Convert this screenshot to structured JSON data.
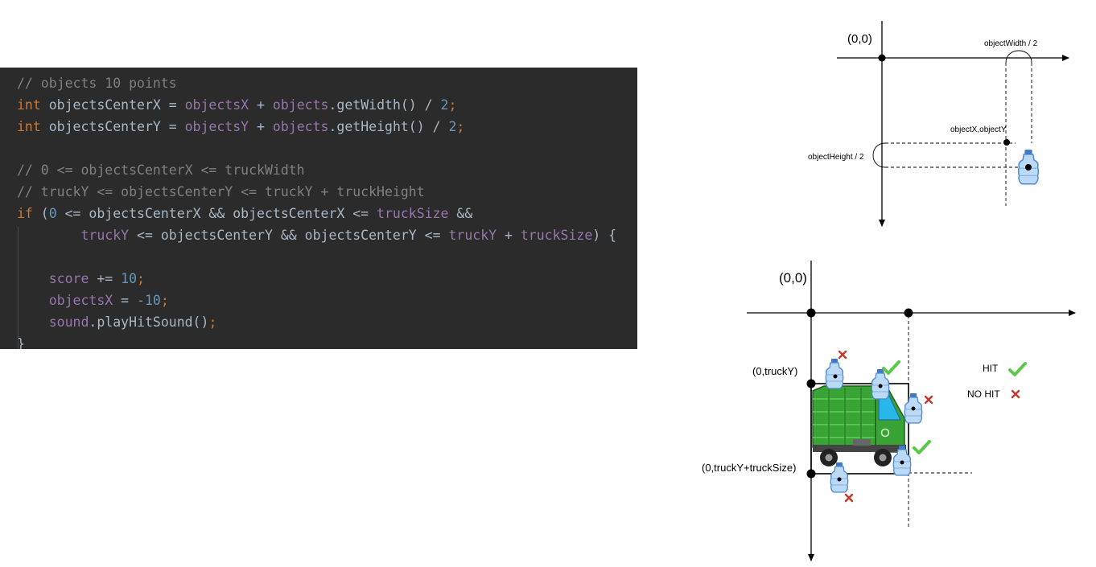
{
  "code": {
    "lines": [
      [
        {
          "t": "// objects 10 points",
          "c": "comment"
        }
      ],
      [
        {
          "t": "int",
          "c": "keyword"
        },
        {
          "t": " objectsCenterX = ",
          "c": "ident"
        },
        {
          "t": "objectsX",
          "c": "field"
        },
        {
          "t": " + ",
          "c": "plain"
        },
        {
          "t": "objects",
          "c": "field"
        },
        {
          "t": ".getWidth() / ",
          "c": "method"
        },
        {
          "t": "2",
          "c": "number"
        },
        {
          "t": ";",
          "c": "keyword"
        }
      ],
      [
        {
          "t": "int",
          "c": "keyword"
        },
        {
          "t": " objectsCenterY = ",
          "c": "ident"
        },
        {
          "t": "objectsY",
          "c": "field"
        },
        {
          "t": " + ",
          "c": "plain"
        },
        {
          "t": "objects",
          "c": "field"
        },
        {
          "t": ".getHeight() / ",
          "c": "method"
        },
        {
          "t": "2",
          "c": "number"
        },
        {
          "t": ";",
          "c": "keyword"
        }
      ],
      [],
      [
        {
          "t": "// 0 <= objectsCenterX <= truckWidth",
          "c": "comment"
        }
      ],
      [
        {
          "t": "// truckY <= objectsCenterY <= truckY + truckHeight",
          "c": "comment"
        }
      ],
      [
        {
          "t": "if",
          "c": "keyword"
        },
        {
          "t": " (",
          "c": "plain"
        },
        {
          "t": "0",
          "c": "number"
        },
        {
          "t": " <= objectsCenterX && objectsCenterX <= ",
          "c": "plain"
        },
        {
          "t": "truckSize",
          "c": "field"
        },
        {
          "t": " &&",
          "c": "plain"
        }
      ],
      [
        {
          "t": "        ",
          "c": "plain"
        },
        {
          "t": "truckY",
          "c": "field"
        },
        {
          "t": " <= objectsCenterY && objectsCenterY <= ",
          "c": "plain"
        },
        {
          "t": "truckY",
          "c": "field"
        },
        {
          "t": " + ",
          "c": "plain"
        },
        {
          "t": "truckSize",
          "c": "field"
        },
        {
          "t": ") {",
          "c": "plain"
        }
      ],
      [],
      [
        {
          "t": "    ",
          "c": "plain"
        },
        {
          "t": "score",
          "c": "field"
        },
        {
          "t": " += ",
          "c": "plain"
        },
        {
          "t": "10",
          "c": "number"
        },
        {
          "t": ";",
          "c": "keyword"
        }
      ],
      [
        {
          "t": "    ",
          "c": "plain"
        },
        {
          "t": "objectsX",
          "c": "field"
        },
        {
          "t": " = ",
          "c": "plain"
        },
        {
          "t": "-10",
          "c": "number"
        },
        {
          "t": ";",
          "c": "keyword"
        }
      ],
      [
        {
          "t": "    ",
          "c": "plain"
        },
        {
          "t": "sound",
          "c": "field"
        },
        {
          "t": ".playHitSound()",
          "c": "method"
        },
        {
          "t": ";",
          "c": "keyword"
        }
      ],
      [
        {
          "t": "}",
          "c": "plain"
        }
      ]
    ]
  },
  "diagram_top": {
    "origin_label": "(0,0)",
    "width_label": "objectWidth / 2",
    "height_label": "objectHeight / 2",
    "point_label": "objectX,objectY"
  },
  "diagram_bottom": {
    "origin_label": "(0,0)",
    "truck_y_label": "(0,truckY)",
    "truck_bottom_label": "(0,truckY+truckSize)",
    "legend_hit": "HIT",
    "legend_no_hit": "NO HIT"
  },
  "colors": {
    "code_bg": "#2b2b2b",
    "hit": "#5cc84a",
    "no_hit": "#c0392b",
    "truck": "#3aa335"
  }
}
